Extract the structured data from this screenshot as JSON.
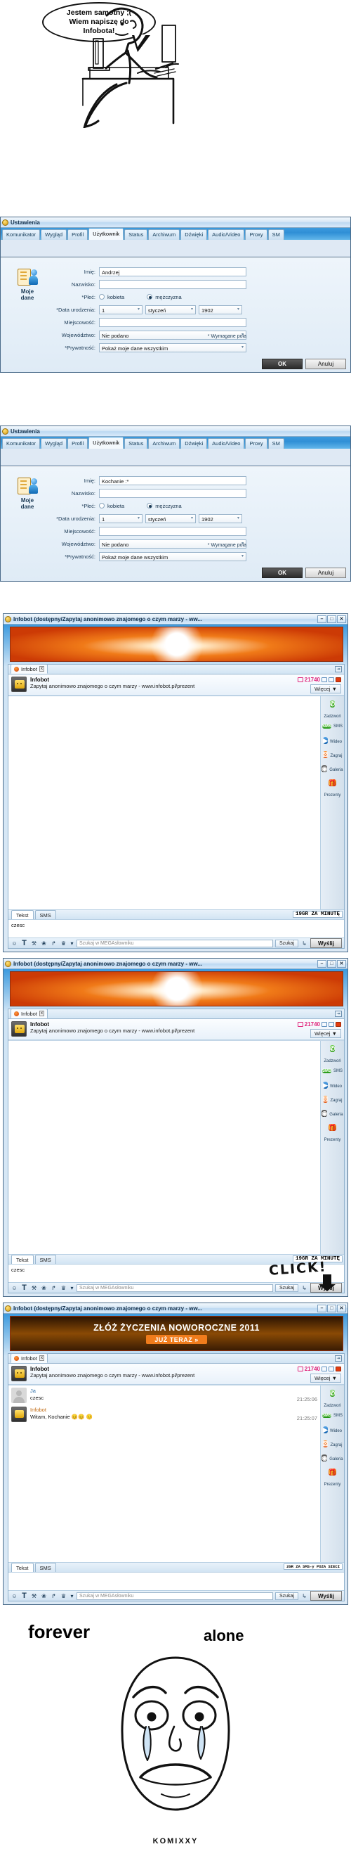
{
  "comic": {
    "speech_bubble": "Jestem samotny ;(\nWiem napiszę do\nInfobota!",
    "alt": "person at desk typing on computer"
  },
  "settings_window": {
    "title": "Ustawienia",
    "tabs": [
      "Komunikator",
      "Wygląd",
      "Profil",
      "Użytkownik",
      "Status",
      "Archiwum",
      "Dźwięki",
      "Audio/Video",
      "Proxy",
      "SM"
    ],
    "selected_tab": "Użytkownik",
    "section_icon_label": "Moje\ndane",
    "section_label_line1": "Moje",
    "section_label_line2": "dane",
    "fields": {
      "first_name_label": "Imię:",
      "last_name_label": "Nazwisko:",
      "gender_label": "*Płeć:",
      "gender_female": "kobieta",
      "gender_male": "mężczyzna",
      "birthdate_label": "*Data urodzenia:",
      "city_label": "Miejscowość:",
      "province_label": "Województwo:",
      "privacy_label": "*Prywatność:"
    },
    "values_first": {
      "first_name": "Andrzej",
      "last_name": "",
      "gender_selected": "mężczyzna",
      "birth_day": "1",
      "birth_month": "styczeń",
      "birth_year": "1902",
      "city": "",
      "province": "Nie podano",
      "privacy": "Pokaż moje dane wszystkim"
    },
    "values_second": {
      "first_name": "Kochanie :*",
      "last_name": "",
      "gender_selected": "mężczyzna",
      "birth_day": "1",
      "birth_month": "styczeń",
      "birth_year": "1902",
      "city": "",
      "province": "Nie podano",
      "privacy": "Pokaż moje dane wszystkim"
    },
    "required_note": "* Wymagane pola",
    "ok_label": "OK",
    "cancel_label": "Anuluj"
  },
  "chat": {
    "window_title": "Infobot (dostępny/Zapytaj anonimowo znajomego o czym marzy - ww...",
    "window_buttons": {
      "minimize": "–",
      "maximize": "□",
      "close": "✕"
    },
    "tab_label": "Infobot",
    "tab_close": "x",
    "contact": {
      "name": "Infobot",
      "description": "Zapytaj anonimowo znajomego o czym marzy - www.infobot.pl/prezent",
      "number": "21740",
      "more_label": "Więcej",
      "more_caret": "▼"
    },
    "sidebar": [
      {
        "label": "Zadzwoń",
        "icon": "phone-icon",
        "glyph": "✆",
        "color": "#2f9c18"
      },
      {
        "label": "SMS",
        "icon": "sms-icon",
        "glyph": "SMS",
        "color": "#1f9112"
      },
      {
        "label": "Wideo",
        "icon": "video-icon",
        "glyph": "▶",
        "color": "#1462ad"
      },
      {
        "label": "Zagraj",
        "icon": "game-dice-icon",
        "glyph": "⚄",
        "color": "#e0500a"
      },
      {
        "label": "Galeria",
        "icon": "camera-icon",
        "glyph": "◉",
        "color": "#2b2b2b"
      },
      {
        "label": "Prezenty",
        "icon": "gift-icon",
        "glyph": "❀",
        "color": "#d22a05"
      }
    ],
    "send_tabs": [
      "Tekst",
      "SMS"
    ],
    "selected_send_tab": "Tekst",
    "price_voice": "19GR ZA MINUTĘ",
    "price_sms": "2GR ZA SMS-y POZA SIECI",
    "composed_text": "czesc",
    "dictionary_placeholder": "Szukaj w MEGAsłowniku",
    "search_button": "Szukaj",
    "send_button": "Wyślij",
    "toolbar_icons": [
      "emoticon-icon",
      "font-icon",
      "wrench-icon",
      "gift-icon",
      "share-icon",
      "crown-icon",
      "chevron-down-icon"
    ],
    "toolbar_glyphs": [
      "☺",
      "T",
      "⚒",
      "❀",
      "↱",
      "♛",
      "▾"
    ],
    "enter_icon": "↳"
  },
  "banners": {
    "clock": {
      "alt": "new year countdown clock banner"
    },
    "newyear": {
      "headline": "ZŁÓŻ ŻYCZENIA NOWOROCZNE 2011",
      "cta": "JUŻ TERAZ",
      "cta_arrow": "»"
    }
  },
  "annotations": {
    "click": "CLICK!"
  },
  "messages": [
    {
      "author": "Ja",
      "text": "czesc",
      "time": "21:25:06",
      "type": "me"
    },
    {
      "author": "Infobot",
      "text": "Witam, Kochanie 😊😊 🙂",
      "time": "21:25:07",
      "type": "bot"
    }
  ],
  "forever_alone": {
    "word1": "forever",
    "word2": "alone"
  },
  "footer": {
    "site": "KOMIXXY"
  },
  "colors": {
    "accent_blue": "#3c9ade",
    "pink_number": "#e0247b",
    "orange_cta": "#f07c1c",
    "green_call": "#2f9c18"
  }
}
